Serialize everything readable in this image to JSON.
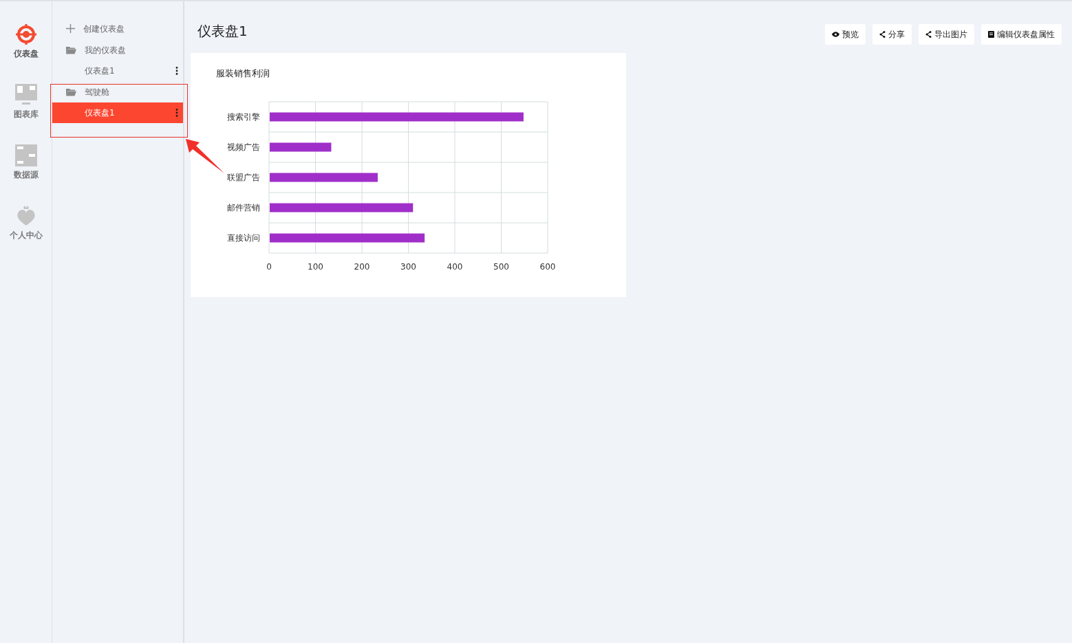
{
  "nav_rail": [
    {
      "label": "仪表盘",
      "selected": true
    },
    {
      "label": "图表库",
      "selected": false
    },
    {
      "label": "数据源",
      "selected": false
    },
    {
      "label": "个人中心",
      "selected": false
    }
  ],
  "tree": [
    {
      "kind": "action",
      "label": "创建仪表盘"
    },
    {
      "kind": "folder",
      "label": "我的仪表盘",
      "children": [
        {
          "label": "仪表盘1",
          "selected": false
        }
      ]
    },
    {
      "kind": "folder",
      "label": "驾驶舱",
      "children": [
        {
          "label": "仪表盘1",
          "selected": true
        }
      ]
    }
  ],
  "page_title": "仪表盘1",
  "toolbar": [
    {
      "kind": "eye",
      "label": "预览"
    },
    {
      "kind": "share",
      "label": "分享"
    },
    {
      "kind": "share",
      "label": "导出图片"
    },
    {
      "kind": "doc",
      "label": "编辑仪表盘属性"
    }
  ],
  "chart_card": {
    "title": "服装销售利润",
    "chart_data": {
      "type": "bar",
      "orientation": "horizontal",
      "categories": [
        "搜索引擎",
        "视频广告",
        "联盟广告",
        "邮件营销",
        "直接访问"
      ],
      "grid": true,
      "series": [
        {
          "color": "#a02fc9",
          "values": [
            548,
            134,
            234,
            310,
            335
          ]
        }
      ],
      "xlim": [
        0,
        600
      ],
      "xticks": [
        0,
        100,
        200,
        300,
        400,
        500,
        600
      ]
    }
  }
}
